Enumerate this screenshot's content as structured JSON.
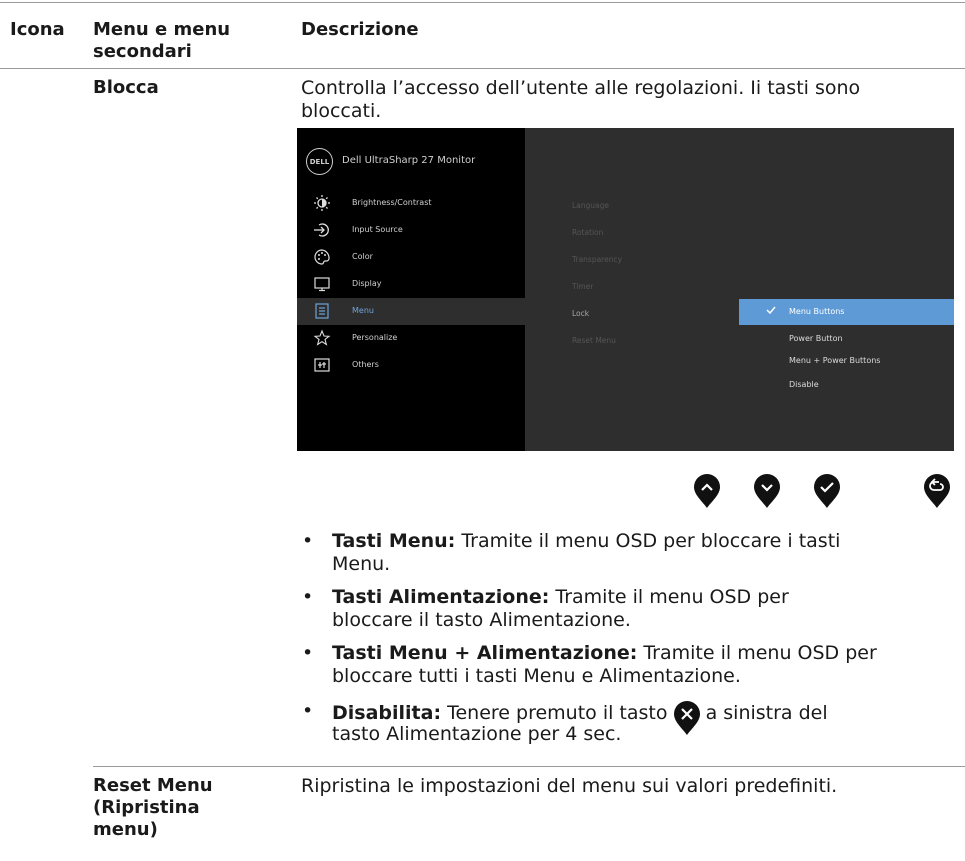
{
  "table": {
    "headers": {
      "icon": "Icona",
      "menu_line1": "Menu e menu",
      "menu_line2": "secondari",
      "description": "Descrizione"
    },
    "rows": [
      {
        "menu": "Blocca",
        "description_line1": "Controlla l’accesso dell’utente alle regolazioni. Ii tasti sono",
        "description_line2": "bloccati."
      },
      {
        "menu_line1": "Reset Menu",
        "menu_line2": "(Ripristina",
        "menu_line3": "menu)",
        "description": "Ripristina le impostazioni del menu sui valori predefiniti."
      }
    ]
  },
  "osd": {
    "logo": "DELL",
    "title": "Dell UltraSharp 27 Monitor",
    "menu_items": [
      {
        "label": "Brightness/Contrast",
        "icon": "sun-icon"
      },
      {
        "label": "Input Source",
        "icon": "input-icon"
      },
      {
        "label": "Color",
        "icon": "palette-icon"
      },
      {
        "label": "Display",
        "icon": "monitor-icon"
      },
      {
        "label": "Menu",
        "icon": "menu-icon",
        "selected": true
      },
      {
        "label": "Personalize",
        "icon": "star-icon"
      },
      {
        "label": "Others",
        "icon": "others-icon"
      }
    ],
    "submenu": [
      "Language",
      "Rotation",
      "Transparency",
      "Timer",
      "Lock",
      "Reset Menu"
    ],
    "options": [
      "Menu Buttons",
      "Power Button",
      "Menu + Power Buttons",
      "Disable"
    ],
    "selected_option": "Menu Buttons",
    "accent_color": "#5e9ad5",
    "buttons": [
      "up-icon",
      "down-icon",
      "check-icon",
      "back-icon"
    ]
  },
  "bullets": [
    {
      "bold": "Tasti Menu:",
      "line1": " Tramite il menu OSD per bloccare i tasti",
      "line2": "Menu."
    },
    {
      "bold": "Tasti Alimentazione:",
      "line1": " Tramite il menu OSD per",
      "line2": "bloccare il tasto Alimentazione."
    },
    {
      "bold": "Tasti Menu + Alimentazione:",
      "line1": " Tramite il menu OSD per",
      "line2": "bloccare tutti i tasti Menu e Alimentazione."
    },
    {
      "bold": "Disabilita:",
      "line1a": " Tenere premuto il tasto ",
      "line1b": " a sinistra del",
      "line2": "tasto Alimentazione per 4 sec."
    }
  ]
}
